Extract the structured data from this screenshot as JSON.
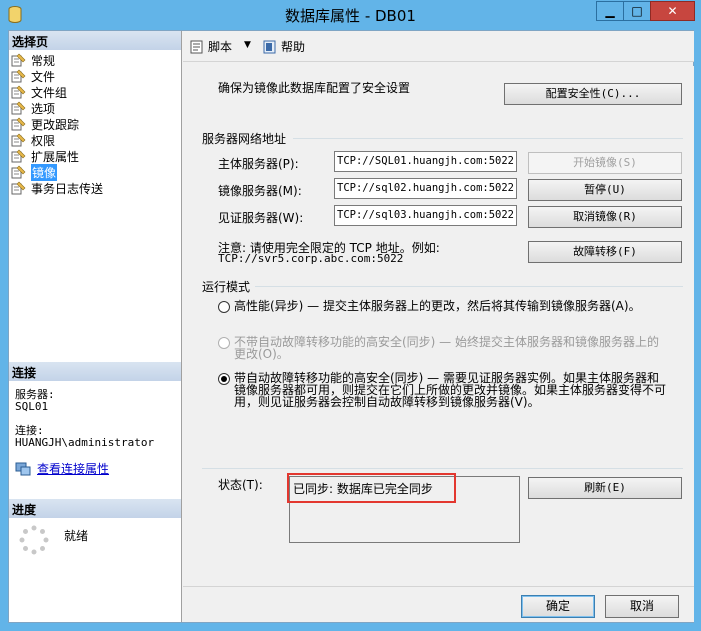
{
  "window": {
    "title": "数据库属性 - DB01",
    "minimize_glyph": "▁",
    "maximize_glyph": "□",
    "close_glyph": "✕"
  },
  "left_panel": {
    "pages_header": "选择页",
    "pages": [
      {
        "label": "常规",
        "icon": "page-icon"
      },
      {
        "label": "文件",
        "icon": "page-icon"
      },
      {
        "label": "文件组",
        "icon": "page-icon"
      },
      {
        "label": "选项",
        "icon": "page-icon"
      },
      {
        "label": "更改跟踪",
        "icon": "page-icon"
      },
      {
        "label": "权限",
        "icon": "page-icon"
      },
      {
        "label": "扩展属性",
        "icon": "page-icon"
      },
      {
        "label": "镜像",
        "icon": "page-icon",
        "selected": true
      },
      {
        "label": "事务日志传送",
        "icon": "page-icon"
      }
    ],
    "connection_header": "连接",
    "server_label": "服务器:",
    "server_value": "SQL01",
    "connection_label": "连接:",
    "connection_value": "HUANGJH\\administrator",
    "view_connection_link": "查看连接属性",
    "progress_header": "进度",
    "progress_status": "就绪"
  },
  "toolbar": {
    "script_label": "脚本",
    "dropdown_glyph": "▼",
    "help_label": "帮助"
  },
  "security": {
    "instruction": "确保为镜像此数据库配置了安全设置",
    "configure_button": "配置安全性(C)..."
  },
  "network": {
    "group_title": "服务器网络地址",
    "principal_label": "主体服务器(P):",
    "principal_value": "TCP://SQL01.huangjh.com:5022",
    "mirror_label": "镜像服务器(M):",
    "mirror_value": "TCP://sql02.huangjh.com:5022",
    "witness_label": "见证服务器(W):",
    "witness_value": "TCP://sql03.huangjh.com:5022",
    "start_mirroring_button": "开始镜像(S)",
    "pause_button": "暂停(U)",
    "remove_mirroring_button": "取消镜像(R)",
    "failover_button": "故障转移(F)",
    "note_line1": "注意: 请使用完全限定的 TCP 地址。例如:",
    "note_line2": "TCP://svr5.corp.abc.com:5022"
  },
  "operating_mode": {
    "group_title": "运行模式",
    "options": [
      {
        "text": "高性能(异步) — 提交主体服务器上的更改，然后将其传输到镜像服务器(A)。",
        "checked": false,
        "enabled": true
      },
      {
        "text_line1": "不带自动故障转移功能的高安全(同步) — 始终提交主体服务器和镜像服务器上的",
        "text_line2": "更改(O)。",
        "checked": false,
        "enabled": false
      },
      {
        "text_line1": "带自动故障转移功能的高安全(同步) — 需要见证服务器实例。如果主体服务器和",
        "text_line2": "镜像服务器都可用，则提交在它们上所做的更改并镜像。如果主体服务器变得不可",
        "text_line3": "用，则见证服务器会控制自动故障转移到镜像服务器(V)。",
        "checked": true,
        "enabled": true
      }
    ]
  },
  "status": {
    "label": "状态(T):",
    "value": "已同步: 数据库已完全同步",
    "refresh_button": "刷新(E)",
    "highlight_color": "#e3372f"
  },
  "dialog_buttons": {
    "ok": "确定",
    "cancel": "取消"
  }
}
